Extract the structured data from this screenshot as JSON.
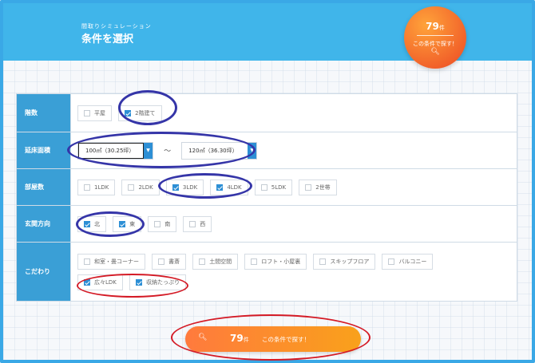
{
  "header": {
    "subtitle": "間取りシミュレーション",
    "title": "条件を選択"
  },
  "count_badge": {
    "count": "79",
    "unit": "件",
    "label": "この条件で探す！",
    "icon": "search-icon"
  },
  "rows": {
    "floors": {
      "label": "階数",
      "options": [
        {
          "label": "平屋",
          "checked": false
        },
        {
          "label": "2階建て",
          "checked": true
        }
      ]
    },
    "area": {
      "label": "延床面積",
      "min": "100㎡（30.25坪）",
      "separator": "〜",
      "max": "120㎡（36.30坪）"
    },
    "rooms": {
      "label": "部屋数",
      "options": [
        {
          "label": "1LDK",
          "checked": false
        },
        {
          "label": "2LDK",
          "checked": false
        },
        {
          "label": "3LDK",
          "checked": true
        },
        {
          "label": "4LDK",
          "checked": true
        },
        {
          "label": "5LDK",
          "checked": false
        },
        {
          "label": "2世帯",
          "checked": false
        }
      ]
    },
    "entrance": {
      "label": "玄関方向",
      "options": [
        {
          "label": "北",
          "checked": true
        },
        {
          "label": "東",
          "checked": true
        },
        {
          "label": "南",
          "checked": false
        },
        {
          "label": "西",
          "checked": false
        }
      ]
    },
    "features": {
      "label": "こだわり",
      "options": [
        {
          "label": "和室・畳コーナー",
          "checked": false
        },
        {
          "label": "書斎",
          "checked": false
        },
        {
          "label": "土間空間",
          "checked": false
        },
        {
          "label": "ロフト・小屋裏",
          "checked": false
        },
        {
          "label": "スキップフロア",
          "checked": false
        },
        {
          "label": "バルコニー",
          "checked": false
        },
        {
          "label": "広々LDK",
          "checked": true
        },
        {
          "label": "収納たっぷり",
          "checked": true
        }
      ]
    }
  },
  "search_button": {
    "count": "79",
    "unit": "件",
    "label": "この条件で探す！",
    "icon": "search-icon"
  },
  "colors": {
    "header": "#40b5ea",
    "label_cell": "#3a9fd6",
    "accent_orange": "#f7931e",
    "checkbox": "#2d8fd5",
    "annotation_blue": "#3535a8",
    "annotation_red": "#d41a25"
  }
}
